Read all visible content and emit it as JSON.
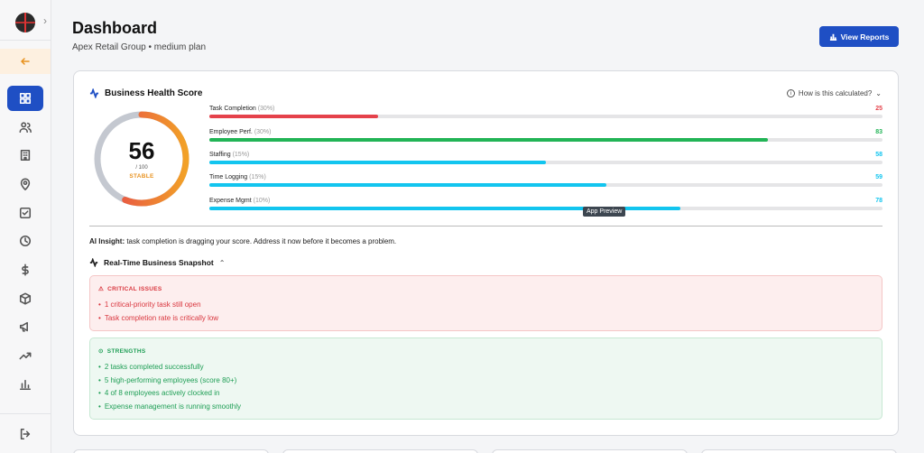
{
  "header": {
    "title": "Dashboard",
    "subtitle": "Apex Retail Group • medium plan",
    "view_reports_label": "View Reports"
  },
  "sidebar": {
    "items": [
      {
        "name": "dashboard",
        "icon": "grid-icon",
        "active": true
      },
      {
        "name": "users",
        "icon": "users-icon"
      },
      {
        "name": "buildings",
        "icon": "building-icon"
      },
      {
        "name": "locations",
        "icon": "map-pin-icon"
      },
      {
        "name": "tasks",
        "icon": "checkbox-icon"
      },
      {
        "name": "time",
        "icon": "clock-icon"
      },
      {
        "name": "expenses",
        "icon": "dollar-icon"
      },
      {
        "name": "inventory",
        "icon": "package-icon"
      },
      {
        "name": "announcements",
        "icon": "megaphone-icon"
      },
      {
        "name": "trends",
        "icon": "trending-up-icon"
      },
      {
        "name": "reports",
        "icon": "bar-chart-icon"
      }
    ]
  },
  "health": {
    "title": "Business Health Score",
    "how_calculated": "How is this calculated?",
    "score": "56",
    "max": "/ 100",
    "status": "STABLE",
    "score_fraction": 0.56,
    "metrics": [
      {
        "label": "Task Completion",
        "weight": "(30%)",
        "value": "25",
        "percent": 25,
        "color": "#e5424b"
      },
      {
        "label": "Employee Perf.",
        "weight": "(30%)",
        "value": "83",
        "percent": 83,
        "color": "#22b456"
      },
      {
        "label": "Staffing",
        "weight": "(15%)",
        "value": "58",
        "percent": 50,
        "color": "#12c5ef"
      },
      {
        "label": "Time Logging",
        "weight": "(15%)",
        "value": "59",
        "percent": 59,
        "color": "#12c5ef"
      },
      {
        "label": "Expense Mgmt",
        "weight": "(10%)",
        "value": "78",
        "percent": 70,
        "color": "#12c5ef"
      }
    ],
    "tooltip": "App Preview"
  },
  "insight": {
    "label": "AI Insight:",
    "text": " task completion is dragging your score. Address it now before it becomes a problem."
  },
  "snapshot": {
    "title": "Real-Time Business Snapshot",
    "critical": {
      "heading": "CRITICAL ISSUES",
      "items": [
        "1 critical-priority task still open",
        "Task completion rate is critically low"
      ]
    },
    "strengths": {
      "heading": "STRENGTHS",
      "items": [
        "2 tasks completed successfully",
        "5 high-performing employees (score 80+)",
        "4 of 8 employees actively clocked in",
        "Expense management is running smoothly"
      ]
    }
  }
}
